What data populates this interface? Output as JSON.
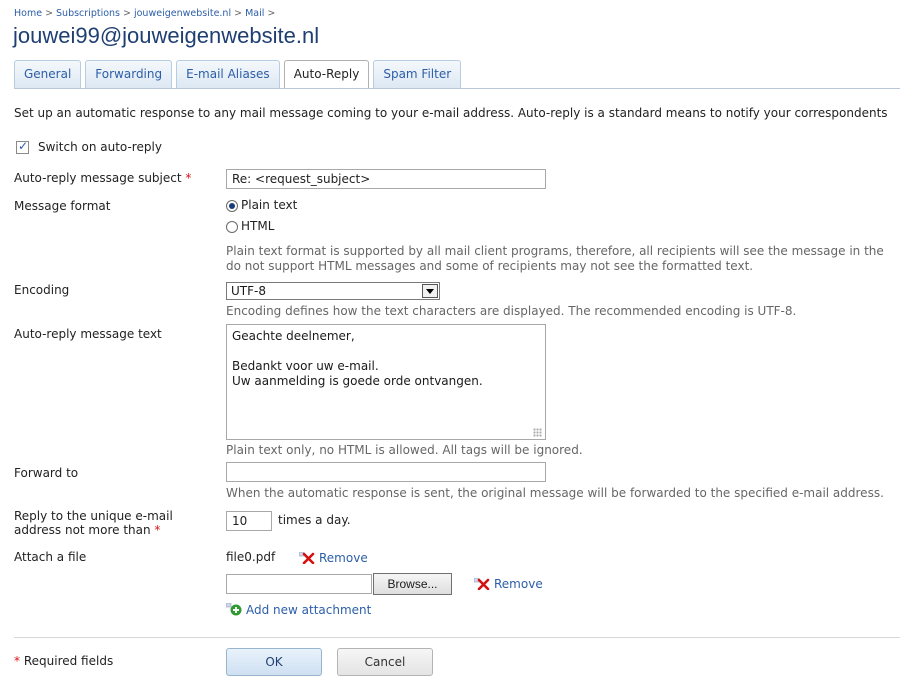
{
  "breadcrumb": [
    "Home",
    "Subscriptions",
    "jouweigenwebsite.nl",
    "Mail"
  ],
  "breadcrumb_separator": ">",
  "title": "jouwei99@jouweigenwebsite.nl",
  "tabs": [
    {
      "label": "General",
      "active": false
    },
    {
      "label": "Forwarding",
      "active": false
    },
    {
      "label": "E-mail Aliases",
      "active": false
    },
    {
      "label": "Auto-Reply",
      "active": true
    },
    {
      "label": "Spam Filter",
      "active": false
    }
  ],
  "intro": "Set up an automatic response to any mail message coming to your e-mail address. Auto-reply is a standard means to notify your correspondents",
  "switch": {
    "label": "Switch on auto-reply",
    "checked": true
  },
  "subject": {
    "label": "Auto-reply message subject",
    "value": "Re: <request_subject>"
  },
  "format": {
    "label": "Message format",
    "options": [
      "Plain text",
      "HTML"
    ],
    "selected": "Plain text",
    "hint_line1": "Plain text format is supported by all mail client programs, therefore, all recipients will see the message in the",
    "hint_line2": "do not support HTML messages and some of recipients may not see the formatted text."
  },
  "encoding": {
    "label": "Encoding",
    "value": "UTF-8",
    "hint": "Encoding defines how the text characters are displayed. The recommended encoding is UTF-8."
  },
  "message": {
    "label": "Auto-reply message text",
    "value": "Geachte deelnemer,\n\nBedankt voor uw e-mail.\nUw aanmelding is goede orde ontvangen.",
    "hint": "Plain text only, no HTML is allowed. All tags will be ignored."
  },
  "forward": {
    "label": "Forward to",
    "value": "",
    "hint": "When the automatic response is sent, the original message will be forwarded to the specified e-mail address."
  },
  "reply_limit": {
    "label_line1": "Reply to the unique e-mail",
    "label_line2": "address not more than",
    "value": "10",
    "suffix": "times a day."
  },
  "attach": {
    "label": "Attach a file",
    "existing_file": "file0.pdf",
    "remove_label": "Remove",
    "browse_label": "Browse...",
    "add_label": "Add new attachment"
  },
  "footer": {
    "required_note": "Required fields",
    "ok_label": "OK",
    "cancel_label": "Cancel"
  },
  "colors": {
    "link": "#2c5ea8",
    "title": "#1f3f72",
    "required": "#dd1111"
  },
  "icons": [
    "check-icon",
    "remove-icon",
    "add-attachment-icon",
    "dropdown-arrow-icon",
    "resize-grip-icon"
  ]
}
